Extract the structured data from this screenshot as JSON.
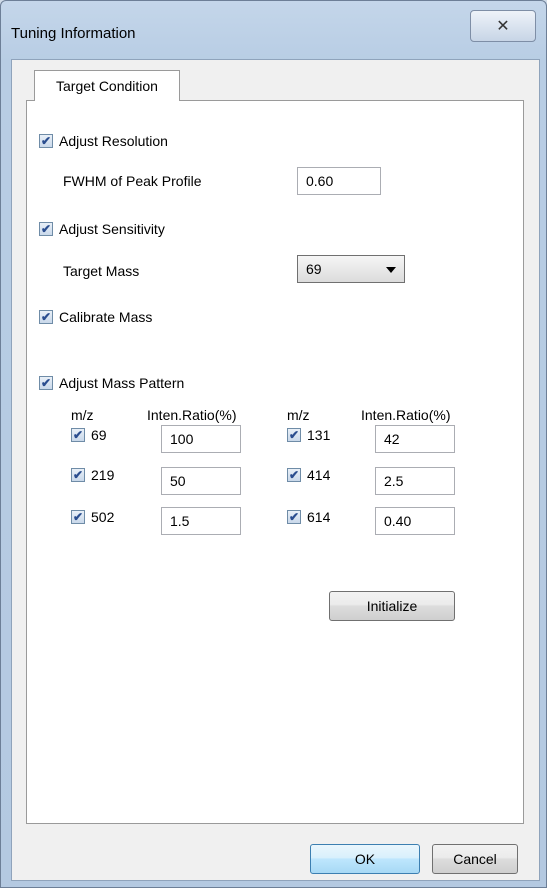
{
  "window": {
    "title": "Tuning Information",
    "close_label": "✕"
  },
  "tabs": [
    {
      "label": "Target Condition"
    }
  ],
  "resolution": {
    "label": "Adjust Resolution",
    "checked": true,
    "fwhm_label": "FWHM of Peak Profile",
    "fwhm_value": "0.60"
  },
  "sensitivity": {
    "label": "Adjust Sensitivity",
    "checked": true,
    "target_mass_label": "Target Mass",
    "target_mass_value": "69"
  },
  "calibrate": {
    "label": "Calibrate Mass",
    "checked": true
  },
  "mass_pattern": {
    "label": "Adjust Mass Pattern",
    "checked": true,
    "col_mz": "m/z",
    "col_ratio": "Inten.Ratio(%)",
    "rows": [
      {
        "left_mz": "69",
        "left_ratio": "100",
        "right_mz": "131",
        "right_ratio": "42"
      },
      {
        "left_mz": "219",
        "left_ratio": "50",
        "right_mz": "414",
        "right_ratio": "2.5"
      },
      {
        "left_mz": "502",
        "left_ratio": "1.5",
        "right_mz": "614",
        "right_ratio": "0.40"
      }
    ]
  },
  "buttons": {
    "initialize": "Initialize",
    "ok": "OK",
    "cancel": "Cancel"
  },
  "icons": {
    "checkmark": "✔"
  }
}
